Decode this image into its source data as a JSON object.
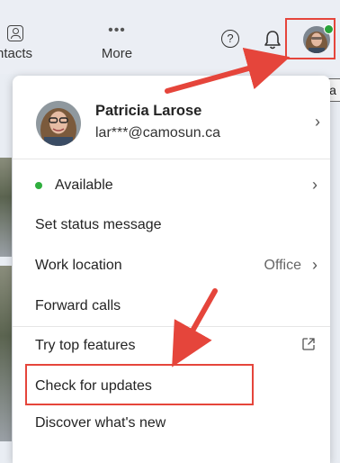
{
  "topbar": {
    "contacts_label": "ntacts",
    "more_dots": "•••",
    "more_label": "More",
    "help_glyph": "?"
  },
  "tooltip": {
    "text": "Ava"
  },
  "profile": {
    "name": "Patricia Larose",
    "email": "lar***@camosun.ca"
  },
  "menu": {
    "status_label": "Available",
    "set_status_label": "Set status message",
    "work_location_label": "Work location",
    "work_location_value": "Office",
    "forward_calls_label": "Forward calls",
    "try_features_label": "Try top features",
    "check_updates_label": "Check for updates",
    "discover_label": "Discover what's new"
  },
  "colors": {
    "accent_red": "#e5453b",
    "presence_green": "#2fae3e"
  }
}
